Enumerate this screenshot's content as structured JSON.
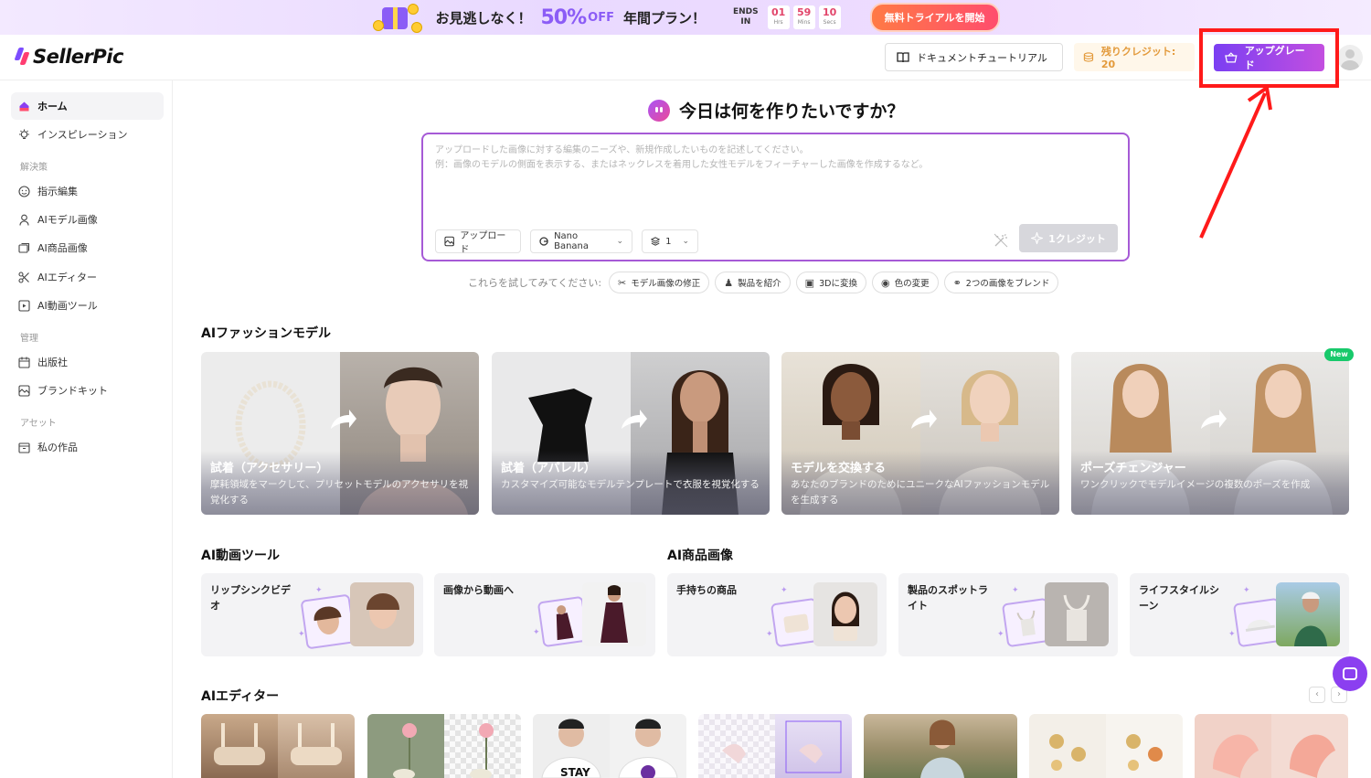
{
  "promo": {
    "text1": "お見逃しなく！",
    "percent": "50%",
    "off": "OFF",
    "text2": "年間プラン！",
    "ends_line1": "ENDS",
    "ends_line2": "IN",
    "countdown": [
      {
        "value": "01",
        "unit": "Hrs"
      },
      {
        "value": "59",
        "unit": "Mins"
      },
      {
        "value": "10",
        "unit": "Secs"
      }
    ],
    "trial_label": "無料トライアルを開始"
  },
  "header": {
    "logo": "SellerPic",
    "docs_label": "ドキュメントチュートリアル",
    "credits_label": "残りクレジット: 20",
    "upgrade_label": "アップグレード"
  },
  "sidebar": {
    "items": [
      {
        "label": "ホーム",
        "icon": "home-icon",
        "active": true
      },
      {
        "label": "インスピレーション",
        "icon": "lightbulb-icon"
      }
    ],
    "group_solutions": "解決策",
    "solutions": [
      {
        "label": "指示編集",
        "icon": "smile-icon"
      },
      {
        "label": "AIモデル画像",
        "icon": "person-icon"
      },
      {
        "label": "AI商品画像",
        "icon": "product-icon"
      },
      {
        "label": "AIエディター",
        "icon": "scissors-icon"
      },
      {
        "label": "AI動画ツール",
        "icon": "video-icon"
      }
    ],
    "group_manage": "管理",
    "manage": [
      {
        "label": "出版社",
        "icon": "calendar-icon"
      },
      {
        "label": "ブランドキット",
        "icon": "brand-icon"
      }
    ],
    "group_assets": "アセット",
    "assets": [
      {
        "label": "私の作品",
        "icon": "folder-icon"
      }
    ]
  },
  "hero": {
    "title": "今日は何を作りたいですか？",
    "placeholder_line1": "アップロードした画像に対する編集のニーズや、新規作成したいものを記述してください。",
    "placeholder_line2": "例：画像のモデルの側面を表示する、またはネックレスを着用した女性モデルをフィーチャーした画像を作成するなど。",
    "upload_label": "アップロード",
    "model_label": "Nano Banana",
    "count_label": "1",
    "generate_label": "1クレジット"
  },
  "tries": {
    "label": "これらを試してみてください:",
    "chips": [
      {
        "label": "モデル画像の修正",
        "icon": "scissors-icon"
      },
      {
        "label": "製品を紹介",
        "icon": "person-icon"
      },
      {
        "label": "3Dに変換",
        "icon": "cube-icon"
      },
      {
        "label": "色の変更",
        "icon": "palette-icon"
      },
      {
        "label": "2つの画像をブレンド",
        "icon": "blend-icon"
      }
    ]
  },
  "fashion": {
    "title": "AIファッションモデル",
    "cards": [
      {
        "title": "試着（アクセサリー）",
        "desc": "摩耗領域をマークして、プリセットモデルのアクセサリを視覚化する"
      },
      {
        "title": "試着（アパレル）",
        "desc": "カスタマイズ可能なモデルテンプレートで衣服を視覚化する"
      },
      {
        "title": "モデルを交換する",
        "desc": "あなたのブランドのためにユニークなAIファッションモデルを生成する"
      },
      {
        "title": "ポーズチェンジャー",
        "desc": "ワンクリックでモデルイメージの複数のポーズを作成",
        "badge": "New"
      }
    ]
  },
  "video": {
    "title": "AI動画ツール",
    "cards": [
      {
        "label": "リップシンクビデオ"
      },
      {
        "label": "画像から動画へ"
      }
    ]
  },
  "product": {
    "title": "AI商品画像",
    "cards": [
      {
        "label": "手持ちの商品"
      },
      {
        "label": "製品のスポットライト"
      },
      {
        "label": "ライフスタイルシーン"
      }
    ]
  },
  "editor": {
    "title": "AIエディター"
  },
  "colors": {
    "accent": "#8b5cf6",
    "upgrade_start": "#7b3ff2",
    "upgrade_end": "#c34fe0",
    "annotation": "#ff1a1a",
    "credit_text": "#e39a3b"
  }
}
